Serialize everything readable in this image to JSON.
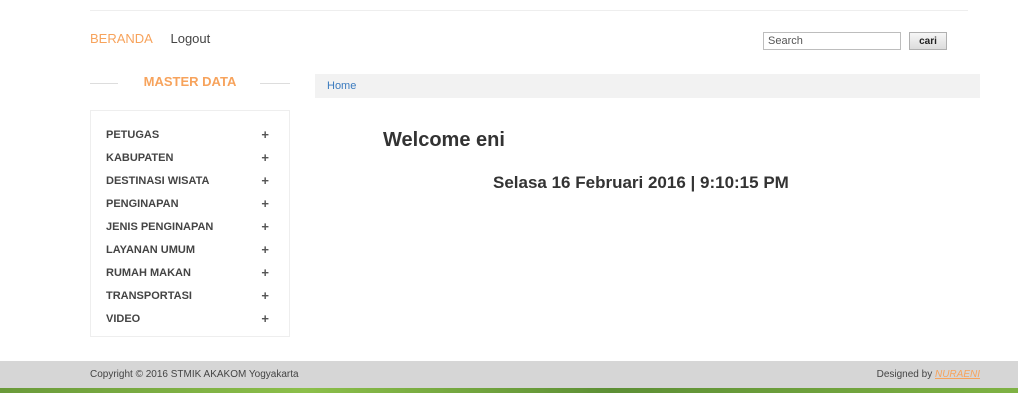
{
  "nav": {
    "home": "BERANDA",
    "logout": "Logout"
  },
  "search": {
    "placeholder": "Search",
    "button": "cari"
  },
  "sidebar": {
    "title": "MASTER DATA",
    "items": [
      {
        "label": "PETUGAS"
      },
      {
        "label": "KABUPATEN"
      },
      {
        "label": "DESTINASI WISATA"
      },
      {
        "label": "PENGINAPAN"
      },
      {
        "label": "JENIS PENGINAPAN"
      },
      {
        "label": "LAYANAN UMUM"
      },
      {
        "label": "RUMAH MAKAN"
      },
      {
        "label": "TRANSPORTASI"
      },
      {
        "label": "VIDEO"
      }
    ],
    "expand_glyph": "+"
  },
  "breadcrumb": {
    "home": "Home"
  },
  "main": {
    "welcome": "Welcome eni",
    "datetime": "Selasa 16 Februari 2016 | 9:10:15 PM"
  },
  "footer": {
    "copyright": "Copyright © 2016 STMIK AKAKOM Yogyakarta",
    "designed_by": "Designed by",
    "author": "NURAENI"
  },
  "colors": {
    "accent": "#f7a35c",
    "link": "#3b7bbf",
    "footer_bg": "#d6d6d6"
  }
}
